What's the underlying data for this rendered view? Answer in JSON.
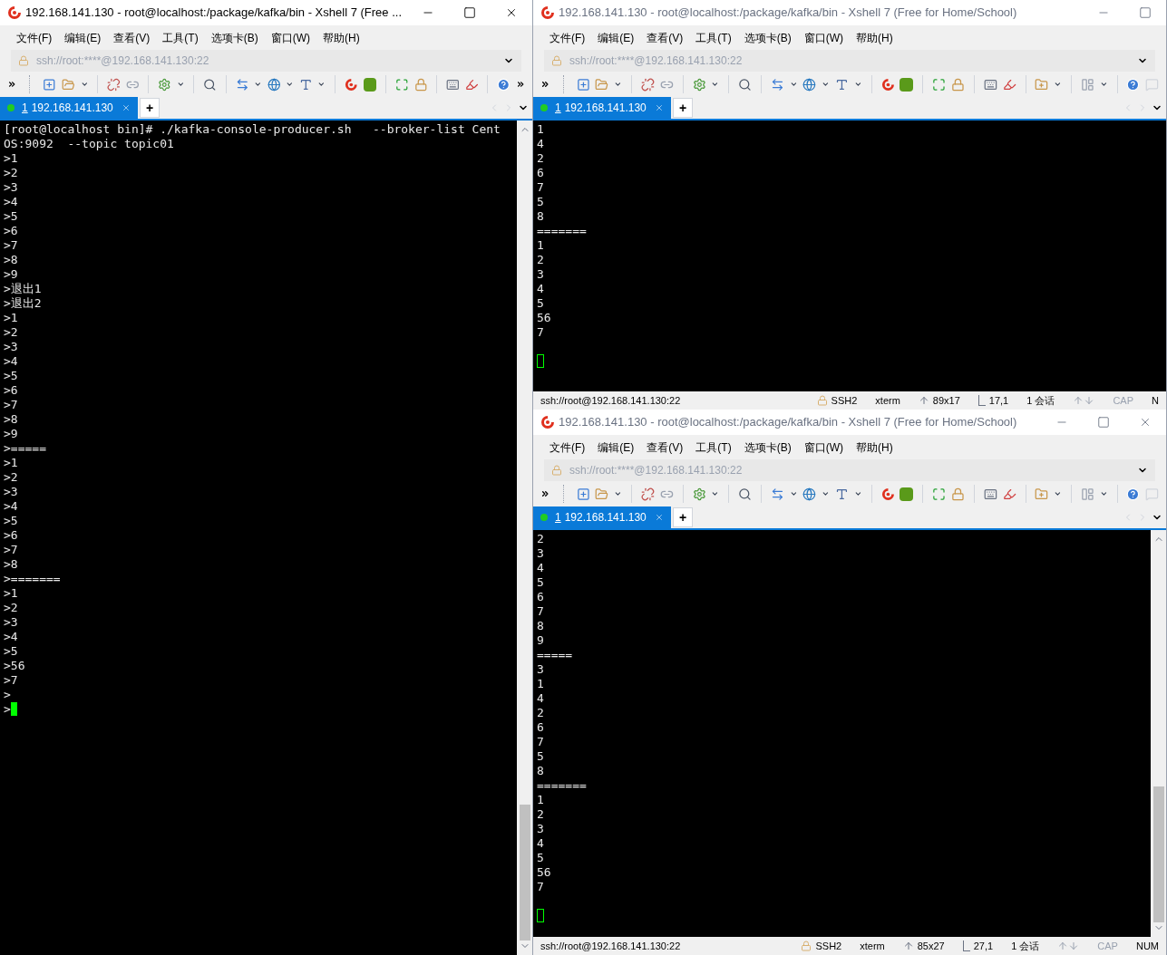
{
  "windows": [
    {
      "title": "192.168.141.130 - root@localhost:/package/kafka/bin - Xshell 7 (Free ...",
      "active": true,
      "close_button": true,
      "menu": [
        "文件(F)",
        "编辑(E)",
        "查看(V)",
        "工具(T)",
        "选项卡(B)",
        "窗口(W)",
        "帮助(H)"
      ],
      "address": "ssh://root:****@192.168.141.130:22",
      "toolbar_overflow": true,
      "tabs": [
        {
          "number": "1",
          "host": "192.168.141.130",
          "selected": true
        }
      ],
      "new_tab": "+",
      "terminal": {
        "scrollbar": true,
        "lines": [
          "[root@localhost bin]# ./kafka-console-producer.sh   --broker-list Cent",
          "OS:9092  --topic topic01",
          ">1",
          ">2",
          ">3",
          ">4",
          ">5",
          ">6",
          ">7",
          ">8",
          ">9",
          ">退出1",
          ">退出2",
          ">1",
          ">2",
          ">3",
          ">4",
          ">5",
          ">6",
          ">7",
          ">8",
          ">9",
          ">=====",
          ">1",
          ">2",
          ">3",
          ">4",
          ">5",
          ">6",
          ">7",
          ">8",
          ">=======",
          ">1",
          ">2",
          ">3",
          ">4",
          ">5",
          ">56",
          ">7",
          ">",
          ">"
        ]
      }
    },
    {
      "title": "192.168.141.130 - root@localhost:/package/kafka/bin - Xshell 7 (Free for Home/School)",
      "active": false,
      "close_button": false,
      "menu": [
        "文件(F)",
        "编辑(E)",
        "查看(V)",
        "工具(T)",
        "选项卡(B)",
        "窗口(W)",
        "帮助(H)"
      ],
      "address": "ssh://root:****@192.168.141.130:22",
      "toolbar_overflow": false,
      "tabs": [
        {
          "number": "1",
          "host": "192.168.141.130",
          "selected": true
        }
      ],
      "new_tab": "+",
      "terminal": {
        "scrollbar": false,
        "lines": [
          "1",
          "4",
          "2",
          "6",
          "7",
          "5",
          "8",
          "=======",
          "1",
          "2",
          "3",
          "4",
          "5",
          "56",
          "7"
        ]
      },
      "status_bar": {
        "address": "ssh://root@192.168.141.130:22",
        "items": [
          {
            "kind": "lock",
            "text": "SSH2"
          },
          {
            "kind": "plain",
            "text": "xterm"
          },
          {
            "kind": "size",
            "text": "89x17"
          },
          {
            "kind": "pos",
            "text": "17,1"
          },
          {
            "kind": "plain",
            "text": "1 会话"
          },
          {
            "kind": "arrows"
          },
          {
            "kind": "dim",
            "text": "CAP"
          },
          {
            "kind": "plain",
            "text": "N"
          }
        ]
      }
    },
    {
      "title": "192.168.141.130 - root@localhost:/package/kafka/bin - Xshell 7 (Free for Home/School)",
      "active": false,
      "close_button": true,
      "menu": [
        "文件(F)",
        "编辑(E)",
        "查看(V)",
        "工具(T)",
        "选项卡(B)",
        "窗口(W)",
        "帮助(H)"
      ],
      "address": "ssh://root:****@192.168.141.130:22",
      "toolbar_overflow": false,
      "tabs": [
        {
          "number": "1",
          "host": "192.168.141.130",
          "selected": true
        }
      ],
      "new_tab": "+",
      "terminal": {
        "scrollbar": true,
        "lines": [
          "2",
          "3",
          "4",
          "5",
          "6",
          "7",
          "8",
          "9",
          "=====",
          "3",
          "1",
          "4",
          "2",
          "6",
          "7",
          "5",
          "8",
          "=======",
          "1",
          "2",
          "3",
          "4",
          "5",
          "56",
          "7"
        ]
      },
      "status_bar": {
        "address": "ssh://root@192.168.141.130:22",
        "items": [
          {
            "kind": "lock",
            "text": "SSH2"
          },
          {
            "kind": "plain",
            "text": "xterm"
          },
          {
            "kind": "size",
            "text": "85x27"
          },
          {
            "kind": "pos",
            "text": "27,1"
          },
          {
            "kind": "plain",
            "text": "1 会话"
          },
          {
            "kind": "arrows"
          },
          {
            "kind": "dim",
            "text": "CAP"
          },
          {
            "kind": "plain",
            "text": "NUM"
          }
        ]
      }
    }
  ]
}
